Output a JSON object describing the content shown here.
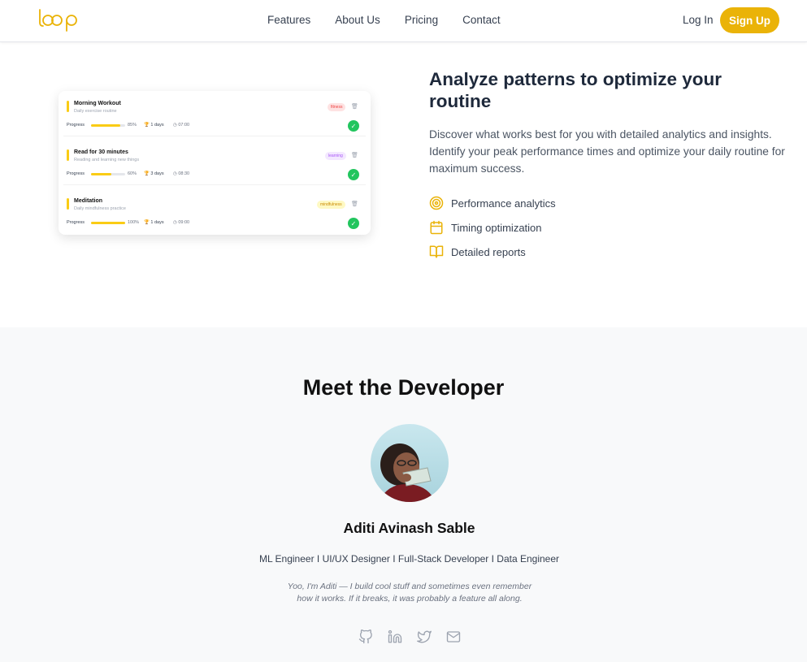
{
  "header": {
    "logo_text": "loop",
    "nav": [
      "Features",
      "About Us",
      "Pricing",
      "Contact"
    ],
    "login_label": "Log In",
    "signup_label": "Sign Up",
    "accent_color": "#eab308"
  },
  "habits": [
    {
      "title": "Morning Workout",
      "subtitle": "Daily exercise routine",
      "tag": "fitness",
      "progress_label": "Progress",
      "percent": "85%",
      "streak": "1 days",
      "time": "07:00"
    },
    {
      "title": "Read for 30 minutes",
      "subtitle": "Reading and learning new things",
      "tag": "learning",
      "progress_label": "Progress",
      "percent": "60%",
      "streak": "3 days",
      "time": "08:30"
    },
    {
      "title": "Meditation",
      "subtitle": "Daily mindfulness practice",
      "tag": "mindfulness",
      "progress_label": "Progress",
      "percent": "100%",
      "streak": "1 days",
      "time": "09:00"
    }
  ],
  "feature": {
    "title": "Analyze patterns to optimize your routine",
    "description": "Discover what works best for you with detailed analytics and insights. Identify your peak performance times and optimize your daily routine for maximum success.",
    "items": [
      {
        "label": "Performance analytics",
        "icon": "target-icon"
      },
      {
        "label": "Timing optimization",
        "icon": "calendar-icon"
      },
      {
        "label": "Detailed reports",
        "icon": "book-open-icon"
      }
    ]
  },
  "developer": {
    "section_title": "Meet the Developer",
    "name": "Aditi Avinash Sable",
    "roles": "ML Engineer I UI/UX Designer I Full-Stack Developer I Data Engineer",
    "bio": "Yoo, I'm Aditi — I build cool stuff and sometimes even remember how it works. If it breaks, it was probably a feature all along.",
    "socials": [
      "github-icon",
      "linkedin-icon",
      "twitter-icon",
      "mail-icon"
    ]
  }
}
